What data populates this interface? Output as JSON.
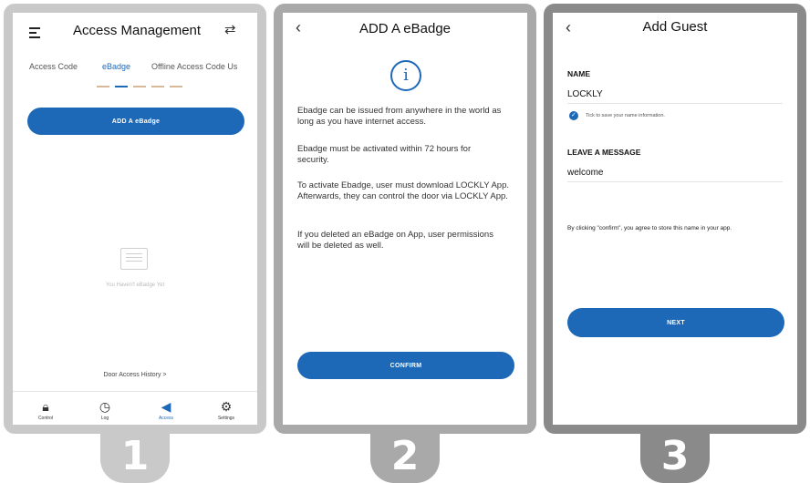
{
  "colors": {
    "accent": "#1e68b8",
    "frame_light": "#c9c9c9",
    "frame_dark": "#8a8a8a"
  },
  "screen1": {
    "menu_icon": "hamburger-icon",
    "title": "Access Management",
    "swap_icon": "swap-arrows-icon",
    "tabs": [
      "Access Code",
      "eBadge",
      "Offline Access Code Us"
    ],
    "add_button": "ADD A eBadge",
    "empty_text": "You Haven't eBadge Yet",
    "history_link": "Door Access History >",
    "nav": [
      {
        "label": "Control",
        "icon": "lock-icon"
      },
      {
        "label": "Log",
        "icon": "clock-icon"
      },
      {
        "label": "Access",
        "icon": "send-icon"
      },
      {
        "label": "Settings",
        "icon": "gear-icon"
      }
    ],
    "step": "1"
  },
  "screen2": {
    "title": "ADD A eBadge",
    "info_icon": "info-icon",
    "paragraphs": [
      "Ebadge can be issued from anywhere in the world as long as you have internet access.",
      "Ebadge must be activated within 72 hours for security.",
      "To activate Ebadge, user must download LOCKLY App. Afterwards, they can control the door via LOCKLY App.",
      "If you deleted an eBadge on App, user permissions will be deleted as well."
    ],
    "confirm_button": "CONFIRM",
    "step": "2"
  },
  "screen3": {
    "title": "Add Guest",
    "name_label": "NAME",
    "name_value": "LOCKLY",
    "save_hint": "Tick to save your name information.",
    "message_label": "LEAVE A MESSAGE",
    "message_value": "welcome",
    "consent_text": "By clicking \"confirm\", you agree to store this name in your app.",
    "next_button": "NEXT",
    "step": "3"
  }
}
